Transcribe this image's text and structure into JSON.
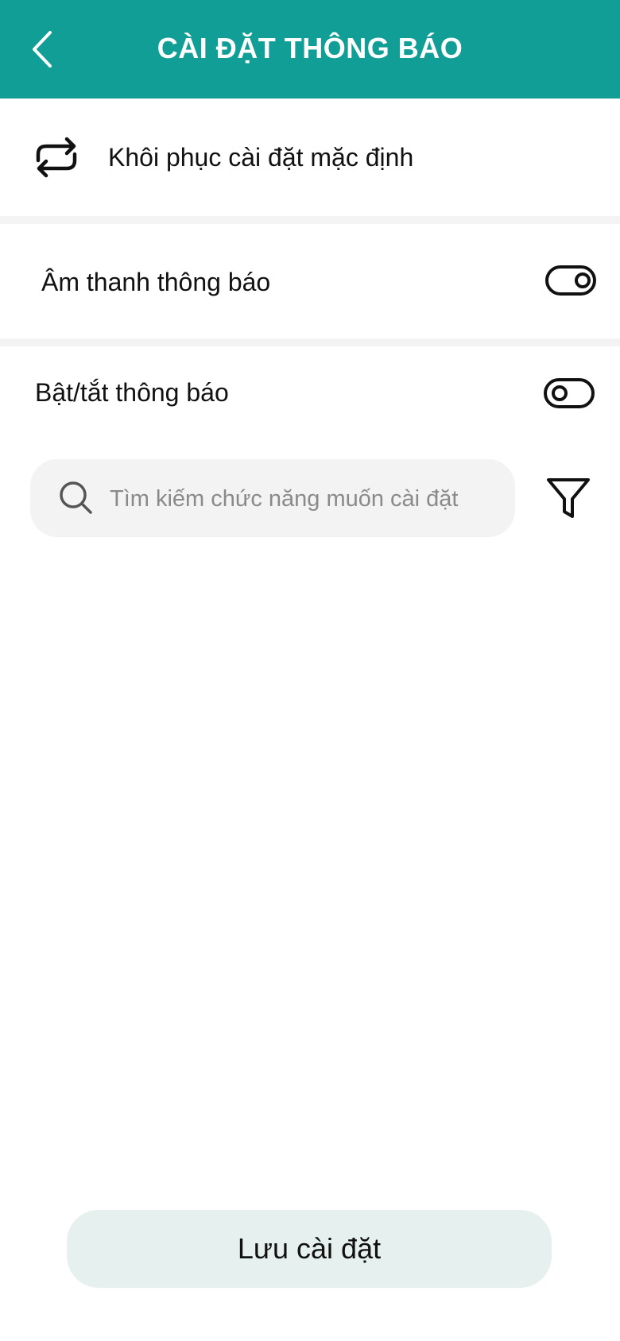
{
  "header": {
    "title": "CÀI ĐẶT THÔNG BÁO",
    "back_icon": "chevron-left-icon",
    "background_color": "#119e96"
  },
  "restore": {
    "label": "Khôi phục cài đặt mặc định",
    "icon": "repeat-icon"
  },
  "sound": {
    "label": "Âm thanh thông báo",
    "enabled": true
  },
  "notifications": {
    "label": "Bật/tắt thông báo",
    "enabled": false
  },
  "search": {
    "placeholder": "Tìm kiếm chức năng muốn cài đặt",
    "value": "",
    "icon": "search-icon"
  },
  "filter": {
    "icon": "filter-icon"
  },
  "footer": {
    "save_label": "Lưu cài đặt",
    "button_color": "#e6f0ee"
  }
}
